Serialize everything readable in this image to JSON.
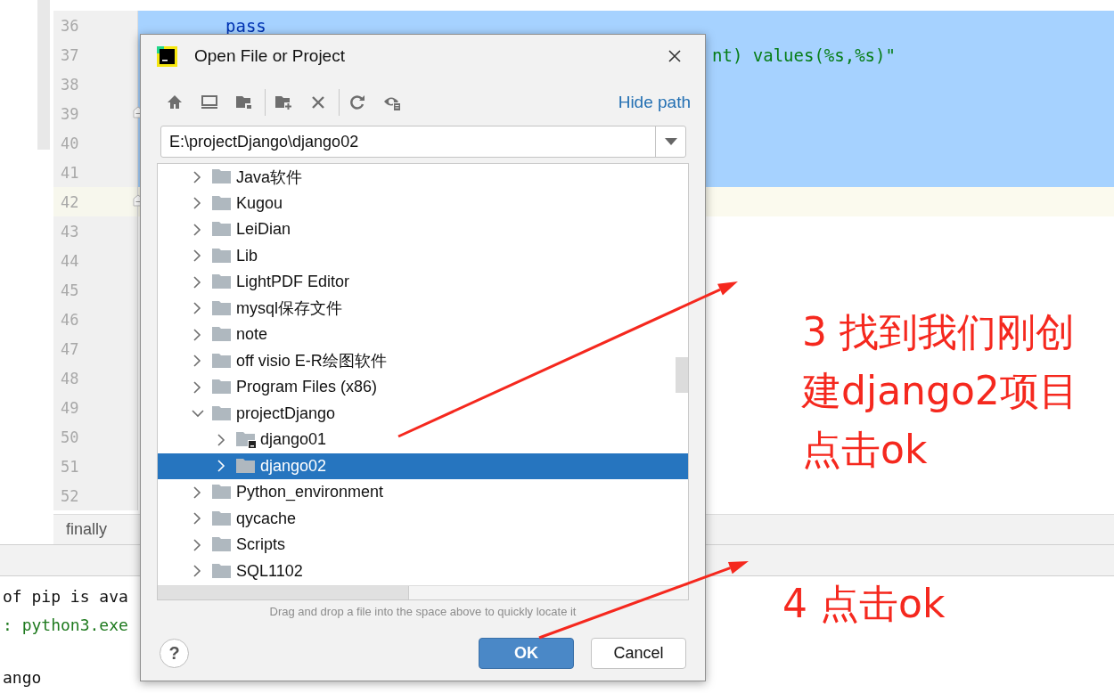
{
  "editor": {
    "lines": [
      {
        "number": "36",
        "code": "pass",
        "kind": "keyword",
        "selected": true,
        "current": false,
        "fold": false
      },
      {
        "number": "37",
        "code": "nt) values(%s,%s)\"",
        "kind": "string",
        "selected": true,
        "current": false,
        "fold": false
      },
      {
        "number": "38",
        "selected": true,
        "current": false,
        "fold": false
      },
      {
        "number": "39",
        "selected": true,
        "current": false,
        "fold": true
      },
      {
        "number": "40",
        "selected": true,
        "current": false,
        "fold": false
      },
      {
        "number": "41",
        "selected": true,
        "current": false,
        "fold": false
      },
      {
        "number": "42",
        "selected": false,
        "current": true,
        "fold": true
      },
      {
        "number": "43",
        "selected": false,
        "current": false,
        "fold": false
      },
      {
        "number": "44",
        "selected": false,
        "current": false,
        "fold": false
      },
      {
        "number": "45",
        "selected": false,
        "current": false,
        "fold": false
      },
      {
        "number": "46",
        "selected": false,
        "current": false,
        "fold": false
      },
      {
        "number": "47",
        "selected": false,
        "current": false,
        "fold": false
      },
      {
        "number": "48",
        "selected": false,
        "current": false,
        "fold": false
      },
      {
        "number": "49",
        "selected": false,
        "current": false,
        "fold": false
      },
      {
        "number": "50",
        "selected": false,
        "current": false,
        "fold": false
      },
      {
        "number": "51",
        "selected": false,
        "current": false,
        "fold": false
      },
      {
        "number": "52",
        "selected": false,
        "current": false,
        "fold": false
      }
    ],
    "breadcrumb": "finally"
  },
  "console": {
    "lines": [
      {
        "text": "of pip is ava",
        "kind": "plain"
      },
      {
        "text": ": python3.exe",
        "kind": "command"
      },
      {
        "text": "ango",
        "kind": "plain"
      }
    ]
  },
  "dialog": {
    "title": "Open File or Project",
    "hide_path": "Hide path",
    "path": "E:\\projectDjango\\django02",
    "tree": [
      {
        "label": "Java软件",
        "expanded": false,
        "selected": false
      },
      {
        "label": "Kugou",
        "expanded": false,
        "selected": false
      },
      {
        "label": "LeiDian",
        "expanded": false,
        "selected": false
      },
      {
        "label": "Lib",
        "expanded": false,
        "selected": false
      },
      {
        "label": "LightPDF Editor",
        "expanded": false,
        "selected": false
      },
      {
        "label": "mysql保存文件",
        "expanded": false,
        "selected": false
      },
      {
        "label": "note",
        "expanded": false,
        "selected": false
      },
      {
        "label": "off visio E-R绘图软件",
        "expanded": false,
        "selected": false
      },
      {
        "label": "Program Files (x86)",
        "expanded": false,
        "selected": false
      },
      {
        "label": "projectDjango",
        "expanded": true,
        "selected": false,
        "children": [
          {
            "label": "django01",
            "expanded": false,
            "selected": false,
            "kind": "project"
          },
          {
            "label": "django02",
            "expanded": false,
            "selected": true,
            "kind": "folder"
          }
        ]
      },
      {
        "label": "Python_environment",
        "expanded": false,
        "selected": false
      },
      {
        "label": "qycache",
        "expanded": false,
        "selected": false
      },
      {
        "label": "Scripts",
        "expanded": false,
        "selected": false
      },
      {
        "label": "SQL1102",
        "expanded": false,
        "selected": false
      }
    ],
    "hint": "Drag and drop a file into the space above to quickly locate it",
    "help": "?",
    "buttons": [
      {
        "label": "OK",
        "kind": "primary"
      },
      {
        "label": "Cancel",
        "kind": "secondary"
      }
    ]
  },
  "annotations": [
    {
      "text": "3 找到我们刚创建django2项目点击ok",
      "kind": "step"
    },
    {
      "text": "4 点击ok",
      "kind": "step"
    }
  ]
}
